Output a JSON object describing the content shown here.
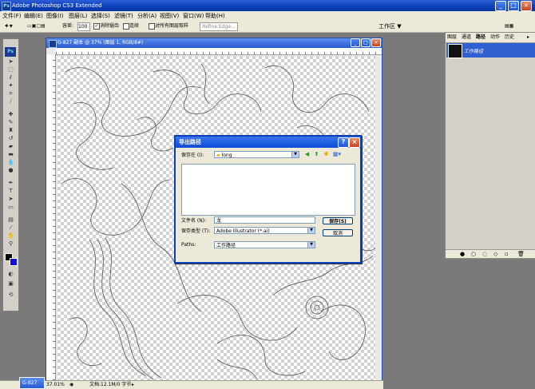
{
  "app": {
    "title": "Adobe Photoshop CS3 Extended",
    "logo_text": "Ps"
  },
  "menu": [
    "文件(F)",
    "编辑(E)",
    "图像(I)",
    "图层(L)",
    "选择(S)",
    "滤镜(T)",
    "分析(A)",
    "视图(V)",
    "窗口(W)",
    "帮助(H)"
  ],
  "options": {
    "tolerance_label": "容差:",
    "tolerance_value": "100",
    "antialias_label": "消除锯齿",
    "antialias_checked": true,
    "contiguous_label": "连续",
    "contiguous_checked": false,
    "all_layers_label": "对所有图层取样",
    "all_layers_checked": false,
    "refine_edge_label": "Refine Edge...",
    "workspace_label": "工作区 ▼"
  },
  "document": {
    "title": "G-827 副本 @ 37% (图层 1, RGB/8#)",
    "zoom": "37.01%",
    "doc_info": "文档:12.1M/0 字节"
  },
  "panel": {
    "tabs": [
      "图层",
      "通道",
      "路径",
      "动作",
      "历史"
    ],
    "active_tab": "路径",
    "path_name": "工作路径"
  },
  "dialog": {
    "title": "导出路径",
    "save_in_label": "保存在 (I):",
    "save_in_value": "long",
    "filename_label": "文件名 (N):",
    "filename_value": "龙",
    "filetype_label": "保存类型 (T):",
    "filetype_value": "Adobe Illustrator (*.ai)",
    "paths_label": "Paths:",
    "paths_value": "工作路径",
    "save_button": "保存(S)",
    "cancel_button": "取消"
  },
  "taskbar": {
    "doc_button": "G-827"
  }
}
